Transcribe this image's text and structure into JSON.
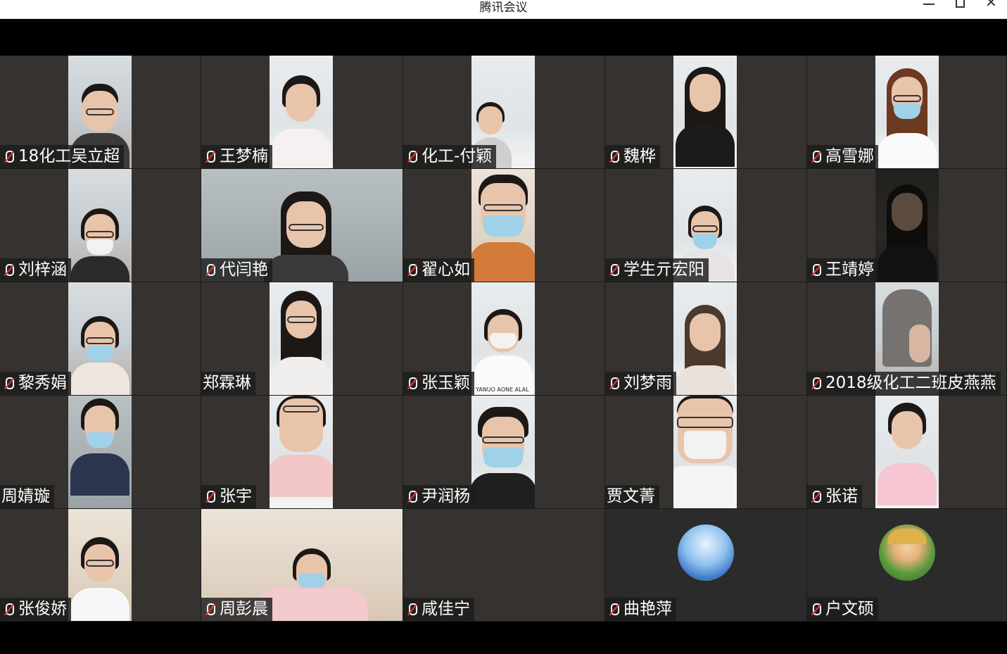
{
  "window": {
    "title": "腾讯会议",
    "minimize_glyph": "—",
    "maximize_glyph": "☐",
    "close_glyph": "✕"
  },
  "participants": [
    {
      "name": "18化工吴立超",
      "muted": true
    },
    {
      "name": "王梦楠",
      "muted": true
    },
    {
      "name": "化工-付颖",
      "muted": true
    },
    {
      "name": "魏桦",
      "muted": true
    },
    {
      "name": "高雪娜",
      "muted": true
    },
    {
      "name": "刘梓涵",
      "muted": true
    },
    {
      "name": "代闫艳",
      "muted": true
    },
    {
      "name": "翟心如",
      "muted": true
    },
    {
      "name": "学生亓宏阳",
      "muted": true
    },
    {
      "name": "王靖婷",
      "muted": true
    },
    {
      "name": "黎秀娟",
      "muted": true
    },
    {
      "name": "郑霖琳",
      "muted": false
    },
    {
      "name": "张玉颖",
      "muted": true
    },
    {
      "name": "刘梦雨",
      "muted": true
    },
    {
      "name": "2018级化工二班皮燕燕",
      "muted": true
    },
    {
      "name": "周婧璇",
      "muted": false
    },
    {
      "name": "张宇",
      "muted": true
    },
    {
      "name": "尹润杨",
      "muted": true
    },
    {
      "name": "贾文菁",
      "muted": false
    },
    {
      "name": "张诺",
      "muted": true
    },
    {
      "name": "张俊娇",
      "muted": true
    },
    {
      "name": "周彭晨",
      "muted": true
    },
    {
      "name": "咸佳宁",
      "muted": true
    },
    {
      "name": "曲艳萍",
      "muted": true
    },
    {
      "name": "户文硕",
      "muted": true
    }
  ],
  "shirt_text": "YANUO AONE ALAL",
  "colors": {
    "tile_bg": "#363230",
    "namebar_bg": "#1c1c1c",
    "muted_icon": "#e53935"
  }
}
